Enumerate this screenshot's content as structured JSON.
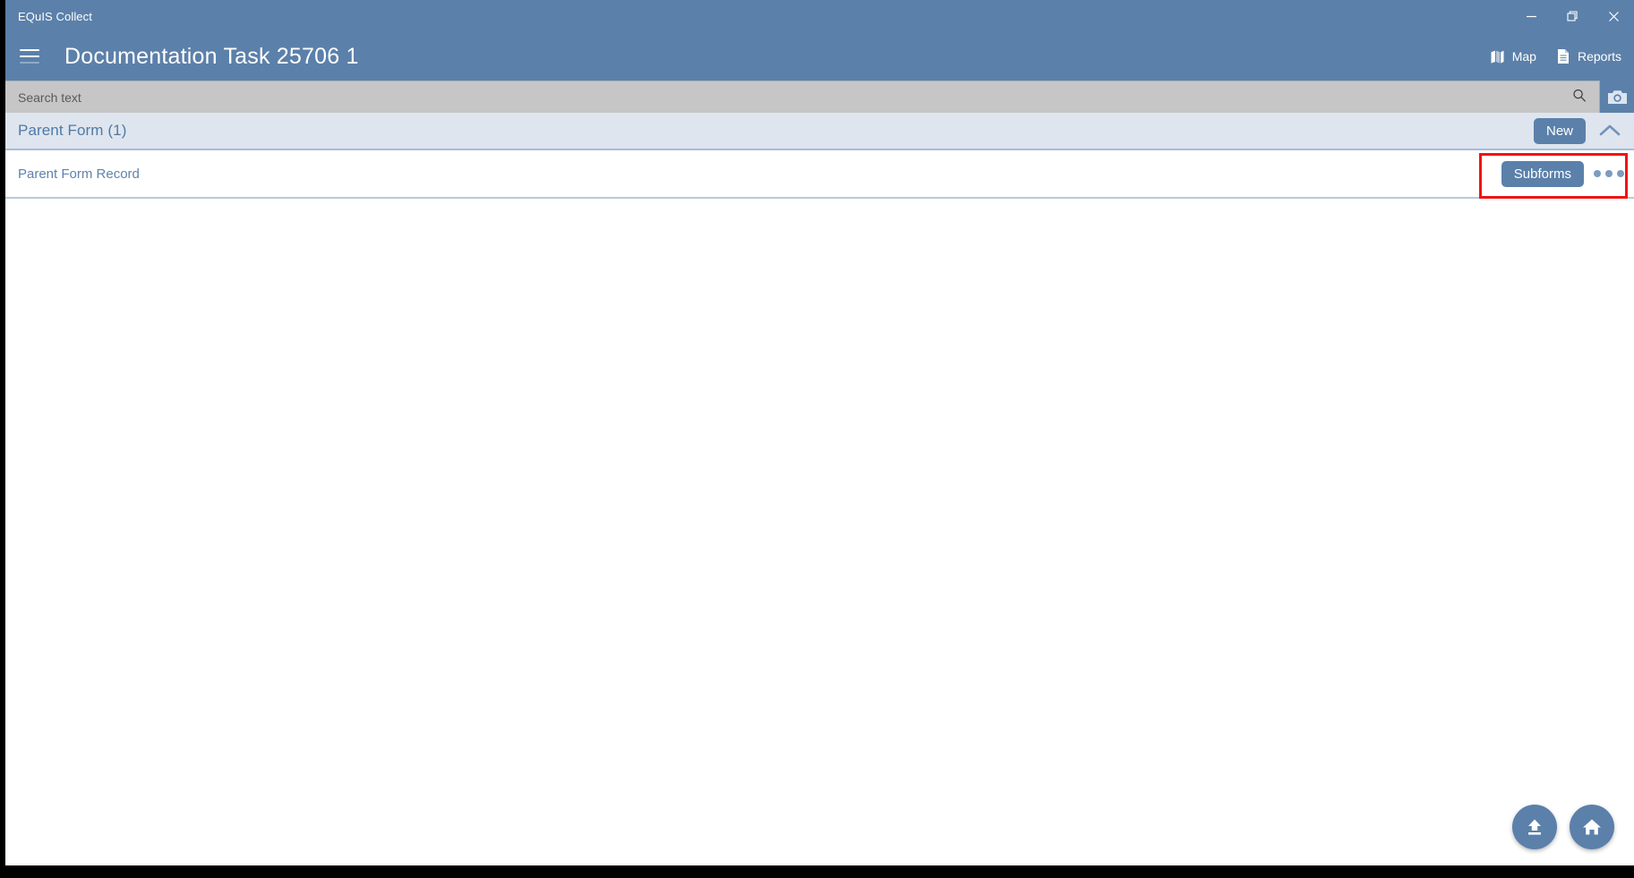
{
  "window": {
    "app_name": "EQuIS Collect",
    "controls": {
      "minimize": "minimize-icon",
      "restore": "restore-icon",
      "close": "close-icon"
    }
  },
  "appbar": {
    "menu_icon": "hamburger-menu-icon",
    "title": "Documentation Task 25706 1",
    "actions": [
      {
        "label": "Map",
        "icon": "map-icon"
      },
      {
        "label": "Reports",
        "icon": "document-icon"
      }
    ]
  },
  "search": {
    "placeholder": "Search text",
    "value": "",
    "search_icon": "search-icon",
    "camera_icon": "camera-icon"
  },
  "section": {
    "title": "Parent Form (1)",
    "new_button": "New",
    "collapse_icon": "chevron-up-icon"
  },
  "record": {
    "label": "Parent Form Record",
    "subforms_button": "Subforms",
    "overflow_icon": "kebab-menu-icon"
  },
  "fabs": [
    {
      "name": "upload-button",
      "icon": "upload-icon"
    },
    {
      "name": "home-button",
      "icon": "home-icon"
    }
  ],
  "annotation": {
    "color": "#f01414",
    "target": "subforms-and-overflow-controls"
  },
  "colors": {
    "accent": "#5b80aa",
    "section_background": "#dfe5ee",
    "search_background": "#c6c6c6",
    "link_text": "#5f82aa"
  }
}
